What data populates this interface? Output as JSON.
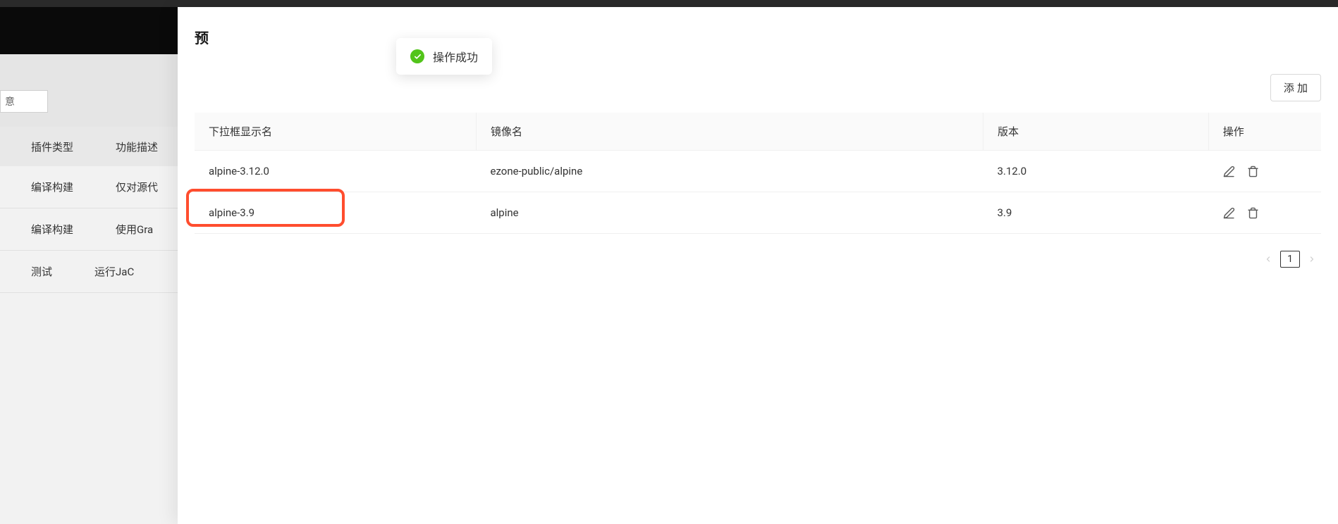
{
  "panel": {
    "title_prefix": "预"
  },
  "toast": {
    "message": "操作成功"
  },
  "toolbar": {
    "add_label": "添 加"
  },
  "table": {
    "headers": {
      "display_name": "下拉框显示名",
      "image_name": "镜像名",
      "version": "版本",
      "action": "操作"
    },
    "rows": [
      {
        "display_name": "alpine-3.12.0",
        "image_name": "ezone-public/alpine",
        "version": "3.12.0"
      },
      {
        "display_name": "alpine-3.9",
        "image_name": "alpine",
        "version": "3.9"
      }
    ]
  },
  "pagination": {
    "current": "1"
  },
  "background": {
    "search_placeholder": "意",
    "headers": {
      "col1": "插件类型",
      "col2": "功能描述"
    },
    "rows": [
      {
        "col1": "编译构建",
        "col2": "仅对源代"
      },
      {
        "col1": "编译构建",
        "col2": "使用Gra"
      },
      {
        "col1": "测试",
        "col2": "运行JaC"
      }
    ]
  }
}
